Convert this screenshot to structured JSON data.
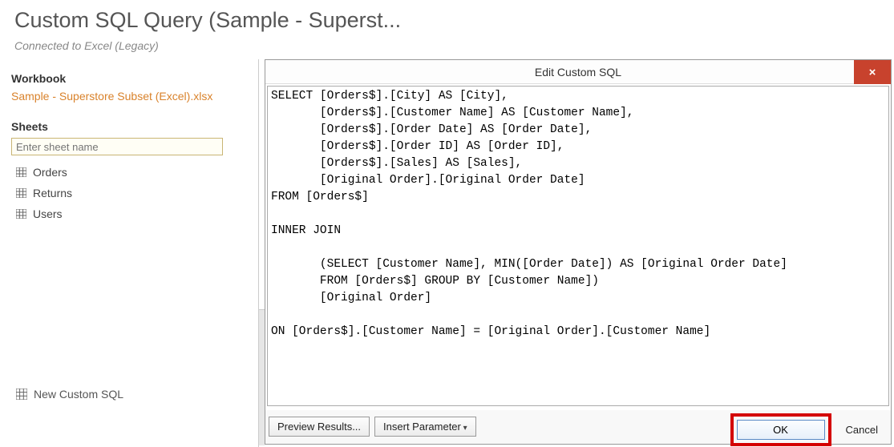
{
  "page": {
    "title": "Custom SQL Query (Sample - Superst...",
    "connected_label": "Connected to Excel (Legacy)"
  },
  "workbook": {
    "header": "Workbook",
    "name": "Sample - Superstore Subset (Excel).xlsx"
  },
  "sheets": {
    "header": "Sheets",
    "input_placeholder": "Enter sheet name",
    "items": [
      {
        "label": "Orders"
      },
      {
        "label": "Returns"
      },
      {
        "label": "Users"
      }
    ]
  },
  "new_custom_sql": {
    "label": "New Custom SQL"
  },
  "dialog": {
    "title": "Edit Custom SQL",
    "close_symbol": "×",
    "sql": "SELECT [Orders$].[City] AS [City],\n       [Orders$].[Customer Name] AS [Customer Name],\n       [Orders$].[Order Date] AS [Order Date],\n       [Orders$].[Order ID] AS [Order ID],\n       [Orders$].[Sales] AS [Sales],\n       [Original Order].[Original Order Date]\nFROM [Orders$]\n\nINNER JOIN\n\n       (SELECT [Customer Name], MIN([Order Date]) AS [Original Order Date]\n       FROM [Orders$] GROUP BY [Customer Name])\n       [Original Order]\n\nON [Orders$].[Customer Name] = [Original Order].[Customer Name]",
    "buttons": {
      "preview": "Preview Results...",
      "insert_param": "Insert Parameter",
      "ok": "OK",
      "cancel": "Cancel"
    }
  }
}
